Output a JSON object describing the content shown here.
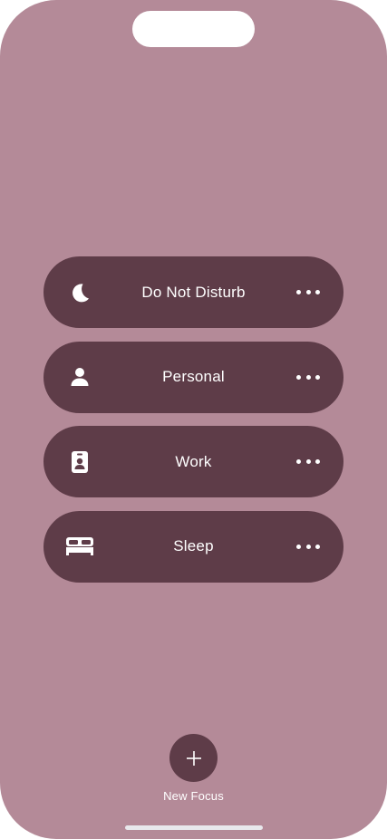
{
  "colors": {
    "screen_background": "#b48a98",
    "pill_background": "#5e3c48",
    "button_background": "#5e3c48",
    "foreground": "#ffffff"
  },
  "focus_modes": [
    {
      "label": "Do Not Disturb",
      "icon": "moon-icon"
    },
    {
      "label": "Personal",
      "icon": "person-icon"
    },
    {
      "label": "Work",
      "icon": "badge-icon"
    },
    {
      "label": "Sleep",
      "icon": "bed-icon"
    }
  ],
  "new_focus": {
    "icon": "plus-icon",
    "label": "New Focus"
  }
}
